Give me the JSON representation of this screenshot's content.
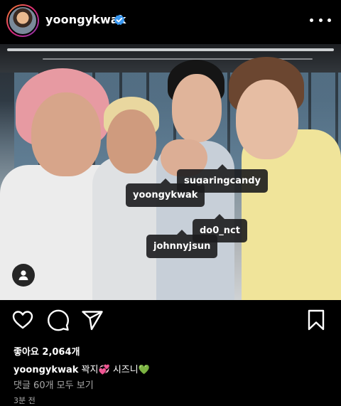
{
  "post": {
    "username": "yoongykwak",
    "verified": true,
    "likes_text": "좋아요 2,064개",
    "caption": {
      "username": "yoongykwak",
      "text_part1": " 꽉지",
      "emoji1": "💞",
      "text_part2": " 시즈니",
      "emoji2": "💚"
    },
    "comments_link": "댓글 60개 모두 보기",
    "timestamp": "3분 전"
  },
  "photo": {
    "tags": [
      {
        "label": "sugaringcandy"
      },
      {
        "label": "yoongykwak"
      },
      {
        "label": "do0_nct"
      },
      {
        "label": "johnnyjsun"
      }
    ]
  },
  "icons": {
    "like": "heart-icon",
    "comment": "comment-icon",
    "share": "send-icon",
    "save": "bookmark-icon",
    "more": "more-icon",
    "tagged": "user-tag-icon",
    "verified": "verified-badge-icon"
  },
  "colors": {
    "background": "#000000",
    "verified": "#3897f0",
    "muted_text": "#a8a8a8"
  }
}
